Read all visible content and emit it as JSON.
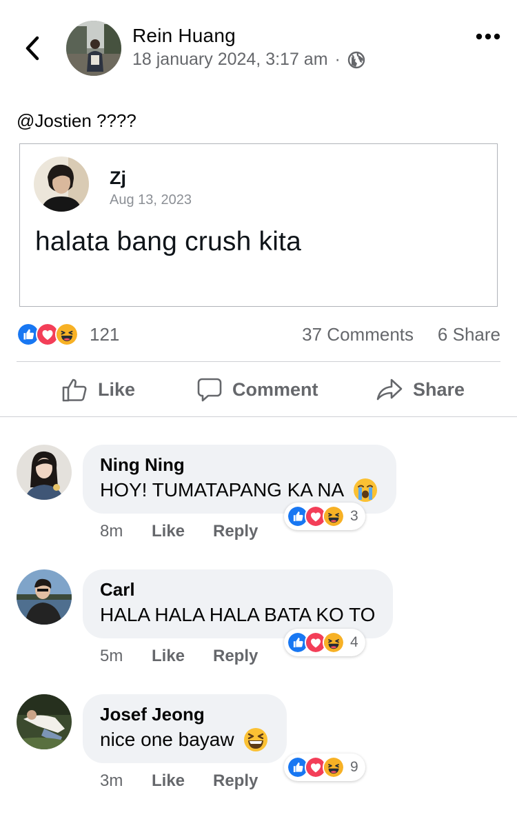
{
  "header": {
    "author_name": "Rein Huang",
    "timestamp": "18 january 2024, 3:17 am",
    "separator": "·",
    "privacy_icon": "globe-icon",
    "back_icon": "chevron-left-icon",
    "more_icon": "more-horizontal-icon"
  },
  "post": {
    "text": "@Jostien ????",
    "shared_tweet": {
      "name": "Zj",
      "date": "Aug 13, 2023",
      "body": "halata bang crush kita"
    }
  },
  "summary": {
    "reactions": [
      "like",
      "love",
      "haha"
    ],
    "reaction_count": "121",
    "comments": "37 Comments",
    "shares": "6 Share"
  },
  "actions": {
    "like": "Like",
    "comment": "Comment",
    "share": "Share"
  },
  "colors": {
    "like_blue": "#1877f2",
    "love_red": "#f33e58",
    "haha_yellow": "#f7b125",
    "meta_gray": "#65676b",
    "bubble_bg": "#f0f2f5"
  },
  "comments": [
    {
      "name": "Ning Ning",
      "text": "HOY! TUMATAPANG KA NA",
      "emoji": "loudly-crying-emoji",
      "time": "8m",
      "like": "Like",
      "reply": "Reply",
      "reaction_count": "3"
    },
    {
      "name": "Carl",
      "text": "HALA HALA HALA BATA KO TO",
      "emoji": "",
      "time": "5m",
      "like": "Like",
      "reply": "Reply",
      "reaction_count": "4"
    },
    {
      "name": "Josef Jeong",
      "text": "nice one bayaw",
      "emoji": "grinning-squinting-emoji",
      "time": "3m",
      "like": "Like",
      "reply": "Reply",
      "reaction_count": "9"
    }
  ]
}
